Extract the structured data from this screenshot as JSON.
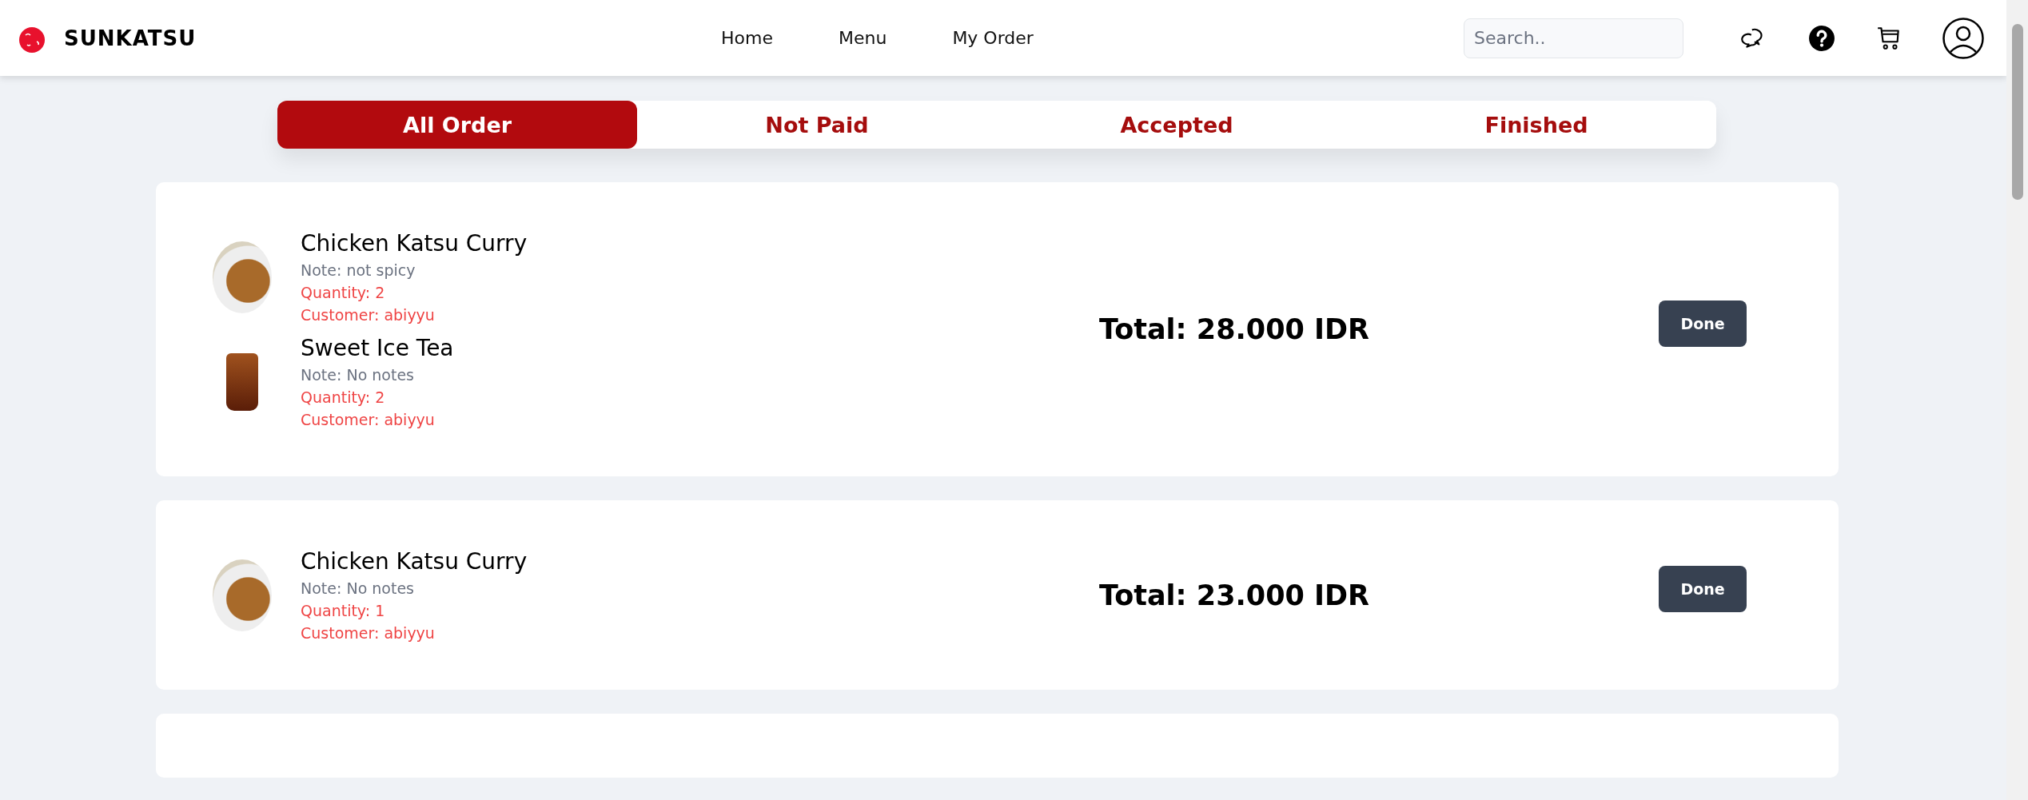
{
  "brand": {
    "name": "SUNKATSU"
  },
  "nav": [
    "Home",
    "Menu",
    "My Order"
  ],
  "search": {
    "placeholder": "Search.."
  },
  "tabs": [
    {
      "label": "All Order",
      "selected": true
    },
    {
      "label": "Not Paid",
      "selected": false
    },
    {
      "label": "Accepted",
      "selected": false
    },
    {
      "label": "Finished",
      "selected": false
    }
  ],
  "orders": [
    {
      "items": [
        {
          "kind": "plate",
          "name": "Chicken Katsu Curry",
          "note": "Note: not spicy",
          "quantity": "Quantity: 2",
          "customer": "Customer: abiyyu"
        },
        {
          "kind": "glass",
          "name": "Sweet Ice Tea",
          "note": "Note: No notes",
          "quantity": "Quantity: 2",
          "customer": "Customer: abiyyu"
        }
      ],
      "total": "Total: 28.000 IDR",
      "button": "Done"
    },
    {
      "items": [
        {
          "kind": "plate",
          "name": "Chicken Katsu Curry",
          "note": "Note: No notes",
          "quantity": "Quantity: 1",
          "customer": "Customer: abiyyu"
        }
      ],
      "total": "Total: 23.000 IDR",
      "button": "Done"
    }
  ]
}
